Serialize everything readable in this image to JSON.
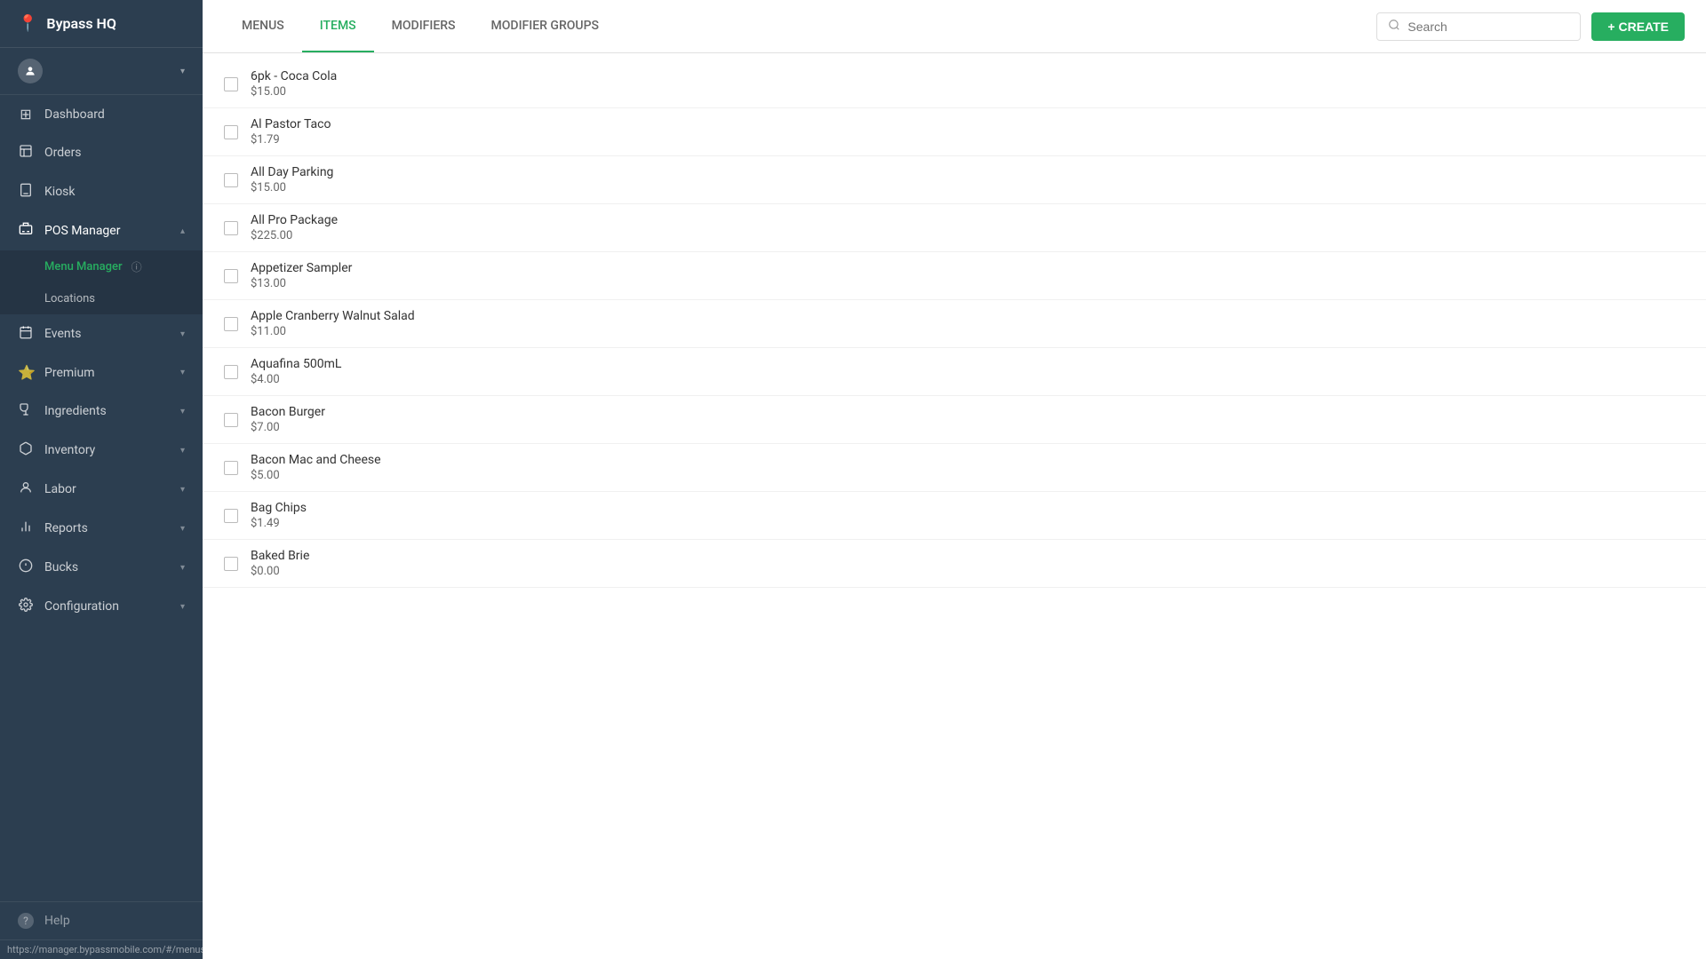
{
  "brand": {
    "name": "Bypass HQ",
    "icon": "📍"
  },
  "statusbar": {
    "url": "https://manager.bypassmobile.com/#/menus"
  },
  "sidebar": {
    "nav_items": [
      {
        "id": "dashboard",
        "label": "Dashboard",
        "icon": "⊞",
        "has_chevron": false,
        "active": false
      },
      {
        "id": "orders",
        "label": "Orders",
        "icon": "📋",
        "has_chevron": false,
        "active": false
      },
      {
        "id": "kiosk",
        "label": "Kiosk",
        "icon": "🖥",
        "has_chevron": false,
        "active": false
      },
      {
        "id": "pos-manager",
        "label": "POS Manager",
        "icon": "🖨",
        "has_chevron": true,
        "expanded": true,
        "active": false
      },
      {
        "id": "events",
        "label": "Events",
        "icon": "📅",
        "has_chevron": true,
        "expanded": false,
        "active": false
      },
      {
        "id": "premium",
        "label": "Premium",
        "icon": "⭐",
        "has_chevron": true,
        "expanded": false,
        "active": false
      },
      {
        "id": "ingredients",
        "label": "Ingredients",
        "icon": "🧪",
        "has_chevron": true,
        "expanded": false,
        "active": false
      },
      {
        "id": "inventory",
        "label": "Inventory",
        "icon": "📦",
        "has_chevron": true,
        "expanded": false,
        "active": false
      },
      {
        "id": "labor",
        "label": "Labor",
        "icon": "👷",
        "has_chevron": true,
        "expanded": false,
        "active": false
      },
      {
        "id": "reports",
        "label": "Reports",
        "icon": "📊",
        "has_chevron": true,
        "expanded": false,
        "active": false
      },
      {
        "id": "bucks",
        "label": "Bucks",
        "icon": "💲",
        "has_chevron": true,
        "expanded": false,
        "active": false
      },
      {
        "id": "configuration",
        "label": "Configuration",
        "icon": "⚙",
        "has_chevron": true,
        "expanded": false,
        "active": false
      }
    ],
    "pos_subitems": [
      {
        "id": "menu-manager",
        "label": "Menu Manager",
        "active": true
      },
      {
        "id": "locations",
        "label": "Locations",
        "active": false
      }
    ],
    "help": {
      "label": "Help",
      "icon": "?"
    }
  },
  "tabs": [
    {
      "id": "menus",
      "label": "MENUS",
      "active": false
    },
    {
      "id": "items",
      "label": "ITEMS",
      "active": true
    },
    {
      "id": "modifiers",
      "label": "MODIFIERS",
      "active": false
    },
    {
      "id": "modifier-groups",
      "label": "MODIFIER GROUPS",
      "active": false
    }
  ],
  "toolbar": {
    "search_placeholder": "Search",
    "create_label": "+ CREATE"
  },
  "items": [
    {
      "name": "6pk - Coca Cola",
      "price": "$15.00"
    },
    {
      "name": "Al Pastor Taco",
      "price": "$1.79"
    },
    {
      "name": "All Day Parking",
      "price": "$15.00"
    },
    {
      "name": "All Pro Package",
      "price": "$225.00"
    },
    {
      "name": "Appetizer Sampler",
      "price": "$13.00"
    },
    {
      "name": "Apple Cranberry Walnut Salad",
      "price": "$11.00"
    },
    {
      "name": "Aquafina 500mL",
      "price": "$4.00"
    },
    {
      "name": "Bacon Burger",
      "price": "$7.00"
    },
    {
      "name": "Bacon Mac and Cheese",
      "price": "$5.00"
    },
    {
      "name": "Bag Chips",
      "price": "$1.49"
    },
    {
      "name": "Baked Brie",
      "price": "$0.00"
    }
  ]
}
